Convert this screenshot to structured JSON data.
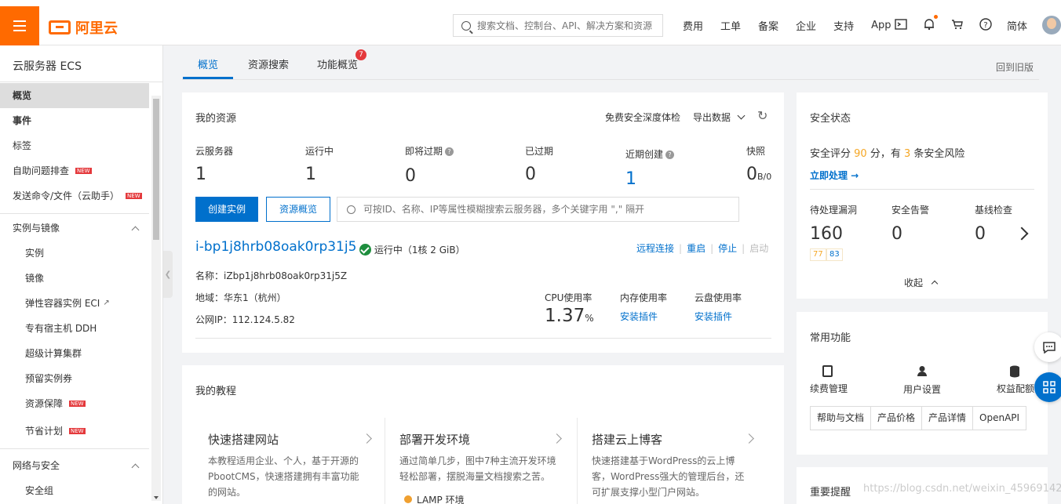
{
  "topbar": {
    "logo_text": "阿里云",
    "search_placeholder": "搜索文档、控制台、API、解决方案和资源",
    "nav": [
      "费用",
      "工单",
      "备案",
      "企业",
      "支持",
      "App"
    ],
    "lang": "简体",
    "accent": "#ff6a00"
  },
  "sidebar": {
    "title": "云服务器 ECS",
    "items": [
      {
        "label": "概览",
        "active": true
      },
      {
        "label": "事件"
      },
      {
        "label": "标签"
      },
      {
        "label": "自助问题排查",
        "tag": "NEW"
      },
      {
        "label": "发送命令/文件（云助手）",
        "tag": "NEW"
      }
    ],
    "group1": "实例与镜像",
    "group1_items": [
      {
        "label": "实例"
      },
      {
        "label": "镜像"
      },
      {
        "label": "弹性容器实例 ECI"
      },
      {
        "label": "专有宿主机 DDH"
      },
      {
        "label": "超级计算集群"
      },
      {
        "label": "预留实例券"
      },
      {
        "label": "资源保障",
        "tag": "NEW"
      },
      {
        "label": "节省计划",
        "tag": "NEW"
      }
    ],
    "group2": "网络与安全",
    "group2_items": [
      {
        "label": "安全组"
      }
    ]
  },
  "tabs": {
    "items": [
      "概览",
      "资源搜索",
      "功能概览"
    ],
    "badge": "7",
    "back_old": "回到旧版"
  },
  "resources": {
    "title": "我的资源",
    "free_check": "免费安全深度体检",
    "export": "导出数据",
    "stats": [
      {
        "label": "云服务器",
        "value": "1"
      },
      {
        "label": "运行中",
        "value": "1"
      },
      {
        "label": "即将过期",
        "value": "0"
      },
      {
        "label": "已过期",
        "value": "0"
      },
      {
        "label": "近期创建",
        "value": "1"
      },
      {
        "label": "快照",
        "value": "0",
        "unit": "B/0"
      }
    ],
    "create_btn": "创建实例",
    "overview_btn": "资源概览",
    "search_placeholder": "可按ID、名称、IP等属性模糊搜索云服务器，多个关键字用 \",\" 隔开",
    "instance": {
      "id": "i-bp1j8hrb08oak0rp31j5",
      "status": "运行中",
      "spec": "（1核 2 GiB）",
      "actions": [
        "远程连接",
        "重启",
        "停止",
        "启动"
      ],
      "name_label": "名称：",
      "name": "iZbp1j8hrb08oak0rp31j5Z",
      "region_label": "地域：",
      "region": "华东1（杭州）",
      "ip_label": "公网IP：",
      "ip": "112.124.5.82",
      "cpu_label": "CPU使用率",
      "cpu_value": "1.37",
      "cpu_unit": "%",
      "mem_label": "内存使用率",
      "mem_link": "安装插件",
      "disk_label": "云盘使用率",
      "disk_link": "安装插件"
    }
  },
  "tutorials": {
    "title": "我的教程",
    "items": [
      {
        "title": "快速搭建网站",
        "desc": [
          "本教程适用企业、个人，基于开源的",
          "PbootCMS，快速搭建拥有丰富功能",
          "的网站。"
        ]
      },
      {
        "title": "部署开发环境",
        "desc": [
          "通过简单几步，图中7种主流开发环境",
          "轻松部署，摆脱海量文档搜索之苦。"
        ],
        "extra": "LAMP 环境"
      },
      {
        "title": "搭建云上博客",
        "desc": [
          "快速搭建基于WordPress的云上博",
          "客，WordPress强大的管理后台，还",
          "可扩展支撑小型门户网站。"
        ]
      }
    ]
  },
  "security": {
    "title": "安全状态",
    "score_prefix": "安全评分",
    "score": "90",
    "score_mid": "分，有",
    "risks": "3",
    "score_suffix": "条安全风险",
    "handle": "立即处理 →",
    "metrics": [
      {
        "label": "待处理漏洞",
        "value": "160"
      },
      {
        "label": "安全告警",
        "value": "0"
      },
      {
        "label": "基线检查",
        "value": "0"
      }
    ],
    "vuln_a": "77",
    "vuln_b": "83",
    "collapse": "收起"
  },
  "common": {
    "title": "常用功能",
    "items": [
      "续费管理",
      "用户设置",
      "权益配额"
    ],
    "tools": [
      "帮助与文档",
      "产品价格",
      "产品详情",
      "OpenAPI"
    ]
  },
  "notice": {
    "title": "重要提醒"
  },
  "watermark": "https://blog.csdn.net/weixin_45969142"
}
